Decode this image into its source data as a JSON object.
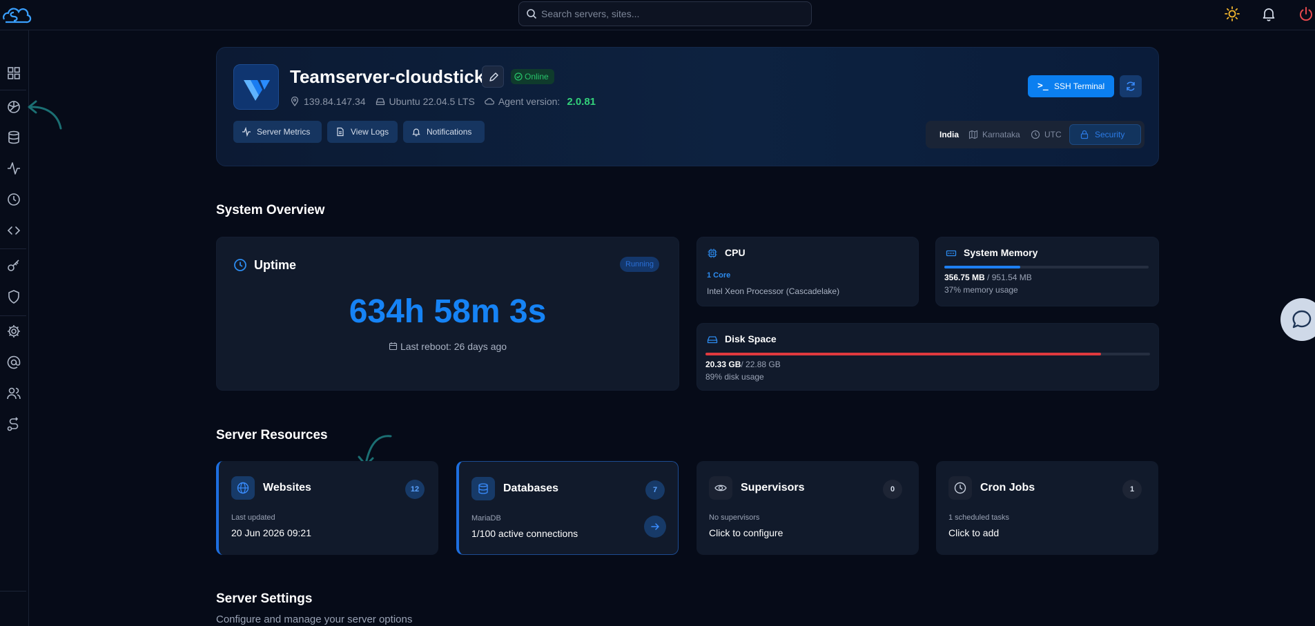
{
  "search": {
    "placeholder": "Search servers, sites..."
  },
  "server": {
    "name": "Teamserver-cloudstick",
    "status": "Online",
    "ip": "139.84.147.34",
    "os": "Ubuntu 22.04.5 LTS",
    "agent_label": "Agent version:",
    "agent_version": "2.0.81",
    "buttons": {
      "metrics": "Server Metrics",
      "logs": "View Logs",
      "notifications": "Notifications",
      "ssh": "SSH Terminal"
    },
    "location": {
      "country": "India",
      "region": "Karnataka",
      "timezone": "UTC",
      "security": "Security"
    }
  },
  "overview": {
    "title": "System Overview",
    "uptime": {
      "title": "Uptime",
      "status": "Running",
      "value": "634h 58m 3s",
      "reboot": "Last reboot: 26 days ago"
    },
    "cpu": {
      "title": "CPU",
      "cores": "1 Core",
      "model": "Intel Xeon Processor (Cascadelake)"
    },
    "memory": {
      "title": "System Memory",
      "used": "356.75 MB",
      "total": "/ 951.54 MB",
      "percent_text": "37% memory usage",
      "fraction": 0.37
    },
    "disk": {
      "title": "Disk Space",
      "used": "20.33 GB",
      "total": "/ 22.88 GB",
      "percent_text": "89% disk usage",
      "fraction": 0.89
    }
  },
  "resources": {
    "title": "Server Resources",
    "items": [
      {
        "title": "Websites",
        "count": "12",
        "sub": "Last updated",
        "main": "20 Jun 2026 09:21"
      },
      {
        "title": "Databases",
        "count": "7",
        "sub": "MariaDB",
        "main": "1/100 active connections"
      },
      {
        "title": "Supervisors",
        "count": "0",
        "sub": "No supervisors",
        "main": "Click to configure"
      },
      {
        "title": "Cron Jobs",
        "count": "1",
        "sub": "1 scheduled tasks",
        "main": "Click to add"
      }
    ]
  },
  "settings": {
    "title": "Server Settings",
    "subtitle": "Configure and manage your server options"
  },
  "colors": {
    "accent": "#1683f5",
    "online": "#28c36b",
    "disk_bar": "#e0393e",
    "memory_bar": "#1d7ff2"
  }
}
